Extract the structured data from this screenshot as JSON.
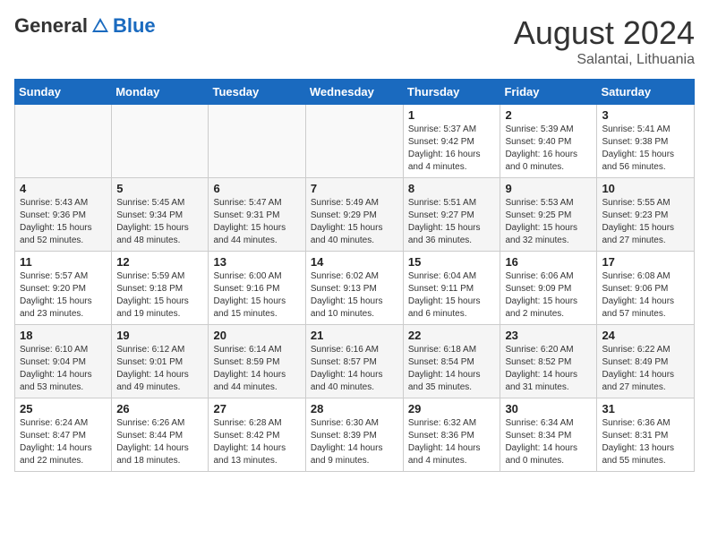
{
  "header": {
    "logo_general": "General",
    "logo_blue": "Blue",
    "month_year": "August 2024",
    "location": "Salantai, Lithuania"
  },
  "weekdays": [
    "Sunday",
    "Monday",
    "Tuesday",
    "Wednesday",
    "Thursday",
    "Friday",
    "Saturday"
  ],
  "weeks": [
    [
      {
        "day": "",
        "details": ""
      },
      {
        "day": "",
        "details": ""
      },
      {
        "day": "",
        "details": ""
      },
      {
        "day": "",
        "details": ""
      },
      {
        "day": "1",
        "details": "Sunrise: 5:37 AM\nSunset: 9:42 PM\nDaylight: 16 hours\nand 4 minutes."
      },
      {
        "day": "2",
        "details": "Sunrise: 5:39 AM\nSunset: 9:40 PM\nDaylight: 16 hours\nand 0 minutes."
      },
      {
        "day": "3",
        "details": "Sunrise: 5:41 AM\nSunset: 9:38 PM\nDaylight: 15 hours\nand 56 minutes."
      }
    ],
    [
      {
        "day": "4",
        "details": "Sunrise: 5:43 AM\nSunset: 9:36 PM\nDaylight: 15 hours\nand 52 minutes."
      },
      {
        "day": "5",
        "details": "Sunrise: 5:45 AM\nSunset: 9:34 PM\nDaylight: 15 hours\nand 48 minutes."
      },
      {
        "day": "6",
        "details": "Sunrise: 5:47 AM\nSunset: 9:31 PM\nDaylight: 15 hours\nand 44 minutes."
      },
      {
        "day": "7",
        "details": "Sunrise: 5:49 AM\nSunset: 9:29 PM\nDaylight: 15 hours\nand 40 minutes."
      },
      {
        "day": "8",
        "details": "Sunrise: 5:51 AM\nSunset: 9:27 PM\nDaylight: 15 hours\nand 36 minutes."
      },
      {
        "day": "9",
        "details": "Sunrise: 5:53 AM\nSunset: 9:25 PM\nDaylight: 15 hours\nand 32 minutes."
      },
      {
        "day": "10",
        "details": "Sunrise: 5:55 AM\nSunset: 9:23 PM\nDaylight: 15 hours\nand 27 minutes."
      }
    ],
    [
      {
        "day": "11",
        "details": "Sunrise: 5:57 AM\nSunset: 9:20 PM\nDaylight: 15 hours\nand 23 minutes."
      },
      {
        "day": "12",
        "details": "Sunrise: 5:59 AM\nSunset: 9:18 PM\nDaylight: 15 hours\nand 19 minutes."
      },
      {
        "day": "13",
        "details": "Sunrise: 6:00 AM\nSunset: 9:16 PM\nDaylight: 15 hours\nand 15 minutes."
      },
      {
        "day": "14",
        "details": "Sunrise: 6:02 AM\nSunset: 9:13 PM\nDaylight: 15 hours\nand 10 minutes."
      },
      {
        "day": "15",
        "details": "Sunrise: 6:04 AM\nSunset: 9:11 PM\nDaylight: 15 hours\nand 6 minutes."
      },
      {
        "day": "16",
        "details": "Sunrise: 6:06 AM\nSunset: 9:09 PM\nDaylight: 15 hours\nand 2 minutes."
      },
      {
        "day": "17",
        "details": "Sunrise: 6:08 AM\nSunset: 9:06 PM\nDaylight: 14 hours\nand 57 minutes."
      }
    ],
    [
      {
        "day": "18",
        "details": "Sunrise: 6:10 AM\nSunset: 9:04 PM\nDaylight: 14 hours\nand 53 minutes."
      },
      {
        "day": "19",
        "details": "Sunrise: 6:12 AM\nSunset: 9:01 PM\nDaylight: 14 hours\nand 49 minutes."
      },
      {
        "day": "20",
        "details": "Sunrise: 6:14 AM\nSunset: 8:59 PM\nDaylight: 14 hours\nand 44 minutes."
      },
      {
        "day": "21",
        "details": "Sunrise: 6:16 AM\nSunset: 8:57 PM\nDaylight: 14 hours\nand 40 minutes."
      },
      {
        "day": "22",
        "details": "Sunrise: 6:18 AM\nSunset: 8:54 PM\nDaylight: 14 hours\nand 35 minutes."
      },
      {
        "day": "23",
        "details": "Sunrise: 6:20 AM\nSunset: 8:52 PM\nDaylight: 14 hours\nand 31 minutes."
      },
      {
        "day": "24",
        "details": "Sunrise: 6:22 AM\nSunset: 8:49 PM\nDaylight: 14 hours\nand 27 minutes."
      }
    ],
    [
      {
        "day": "25",
        "details": "Sunrise: 6:24 AM\nSunset: 8:47 PM\nDaylight: 14 hours\nand 22 minutes."
      },
      {
        "day": "26",
        "details": "Sunrise: 6:26 AM\nSunset: 8:44 PM\nDaylight: 14 hours\nand 18 minutes."
      },
      {
        "day": "27",
        "details": "Sunrise: 6:28 AM\nSunset: 8:42 PM\nDaylight: 14 hours\nand 13 minutes."
      },
      {
        "day": "28",
        "details": "Sunrise: 6:30 AM\nSunset: 8:39 PM\nDaylight: 14 hours\nand 9 minutes."
      },
      {
        "day": "29",
        "details": "Sunrise: 6:32 AM\nSunset: 8:36 PM\nDaylight: 14 hours\nand 4 minutes."
      },
      {
        "day": "30",
        "details": "Sunrise: 6:34 AM\nSunset: 8:34 PM\nDaylight: 14 hours\nand 0 minutes."
      },
      {
        "day": "31",
        "details": "Sunrise: 6:36 AM\nSunset: 8:31 PM\nDaylight: 13 hours\nand 55 minutes."
      }
    ]
  ]
}
